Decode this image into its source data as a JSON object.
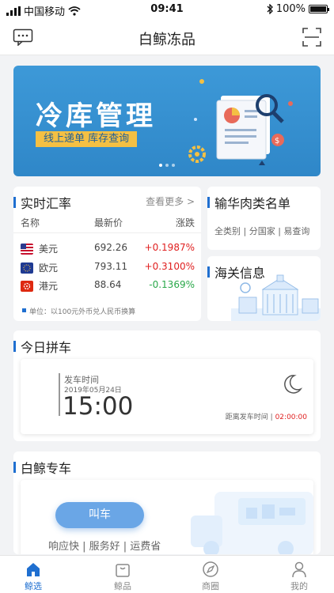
{
  "status_bar": {
    "carrier": "中国移动",
    "time": "09:41",
    "battery": "100%"
  },
  "nav": {
    "title": "白鲸冻品"
  },
  "banner": {
    "title": "冷库管理",
    "subtitle": "线上递单 库存查询"
  },
  "exchange": {
    "title": "实时汇率",
    "more": "查看更多 >",
    "headers": {
      "name": "名称",
      "price": "最新价",
      "change": "涨跌"
    },
    "rows": [
      {
        "name": "美元",
        "price": "692.26",
        "change": "+0.1987%",
        "direction": "up"
      },
      {
        "name": "欧元",
        "price": "793.11",
        "change": "+0.3100%",
        "direction": "up"
      },
      {
        "name": "港元",
        "price": "88.64",
        "change": "-0.1369%",
        "direction": "down"
      }
    ],
    "note": "单位：以100元外币兑人民币换算"
  },
  "meat_list": {
    "title": "输华肉类名单",
    "links": [
      "全类别",
      "分国家",
      "易查询"
    ]
  },
  "customs": {
    "title": "海关信息"
  },
  "carpool": {
    "title": "今日拼车",
    "depart_label": "发车时间",
    "date": "2019年05月24日",
    "time": "15:00",
    "countdown_label": "距离发车时间",
    "countdown": "02:00:00"
  },
  "special": {
    "title": "白鲸专车",
    "call_button": "叫车",
    "taglines": "响应快 | 服务好 | 运费省"
  },
  "tabs": [
    {
      "label": "鲸选",
      "icon": "home-icon",
      "active": true
    },
    {
      "label": "鲸品",
      "icon": "bag-icon",
      "active": false
    },
    {
      "label": "商圈",
      "icon": "compass-icon",
      "active": false
    },
    {
      "label": "我的",
      "icon": "user-icon",
      "active": false
    }
  ],
  "colors": {
    "accent": "#1f6fd0",
    "banner_bg": "#3d99d8",
    "up": "#e02020",
    "down": "#2aa84a"
  }
}
